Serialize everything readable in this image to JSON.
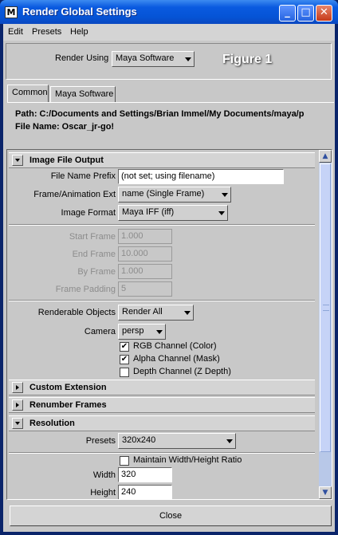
{
  "window": {
    "icon": "maya-icon",
    "title": "Render Global Settings",
    "buttons": {
      "minimize": "_",
      "maximize": "□",
      "close": "✕"
    }
  },
  "menubar": [
    "Edit",
    "Presets",
    "Help"
  ],
  "render_using": {
    "label": "Render Using",
    "value": "Maya Software"
  },
  "watermark": "Figure 1",
  "tabs": [
    {
      "label": "Common",
      "active": true
    },
    {
      "label": "Maya Software",
      "active": false
    }
  ],
  "path": {
    "path_line": "Path: C:/Documents and Settings/Brian Immel/My Documents/maya/p",
    "file_line": "File Name:  Oscar_jr-go!"
  },
  "sections": {
    "image_file_output": "Image File Output",
    "custom_extension": "Custom Extension",
    "renumber_frames": "Renumber Frames",
    "resolution": "Resolution"
  },
  "image_file_output": {
    "file_name_prefix": {
      "label": "File Name Prefix",
      "value": "(not set; using filename)"
    },
    "frame_animation_ext": {
      "label": "Frame/Animation Ext",
      "value": "name (Single Frame)"
    },
    "image_format": {
      "label": "Image Format",
      "value": "Maya IFF (iff)"
    },
    "start_frame": {
      "label": "Start Frame",
      "value": "1.000"
    },
    "end_frame": {
      "label": "End Frame",
      "value": "10.000"
    },
    "by_frame": {
      "label": "By Frame",
      "value": "1.000"
    },
    "frame_padding": {
      "label": "Frame Padding",
      "value": "5"
    },
    "renderable_objects": {
      "label": "Renderable Objects",
      "value": "Render All"
    },
    "camera": {
      "label": "Camera",
      "value": "persp"
    },
    "rgb_channel": {
      "label": "RGB Channel (Color)",
      "checked": true
    },
    "alpha_channel": {
      "label": "Alpha Channel (Mask)",
      "checked": true
    },
    "depth_channel": {
      "label": "Depth Channel (Z Depth)",
      "checked": false
    }
  },
  "resolution": {
    "presets": {
      "label": "Presets",
      "value": "320x240"
    },
    "maintain_ratio": {
      "label": "Maintain Width/Height Ratio",
      "checked": false
    },
    "width": {
      "label": "Width",
      "value": "320"
    },
    "height": {
      "label": "Height",
      "value": "240"
    }
  },
  "scroll": {
    "up": "▲",
    "down": "▼",
    "position": 0.0
  },
  "check_mark": "✔",
  "close_button": "Close"
}
